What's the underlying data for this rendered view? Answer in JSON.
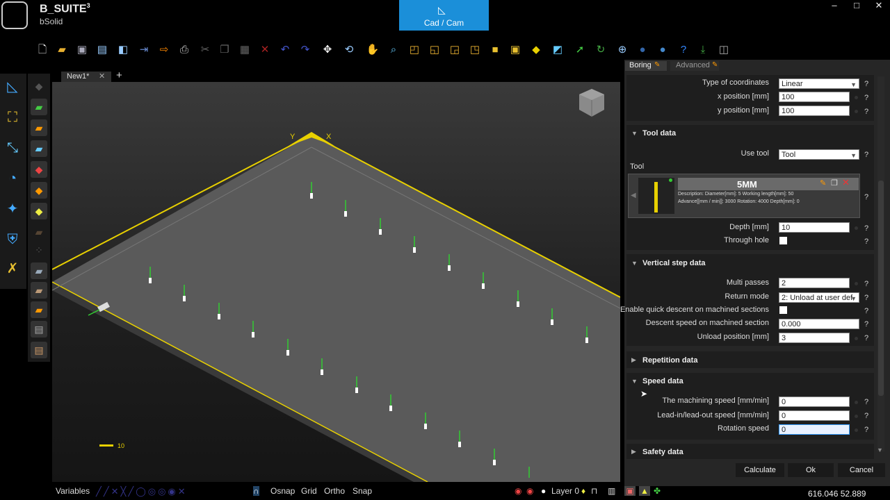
{
  "app": {
    "title": "B_SUITE",
    "title_sup": "3",
    "subtitle": "bSolid"
  },
  "mode_button": {
    "label": "Cad / Cam"
  },
  "window": {
    "minimize": "–",
    "maximize": "□",
    "close": "✕"
  },
  "document_tab": {
    "label": "New1*",
    "close": "✕",
    "add": "+"
  },
  "panel": {
    "tabs": [
      "Boring",
      "Advanced"
    ],
    "coordinates": {
      "type_label": "Type of coordinates",
      "type_value": "Linear",
      "x_label": "x position  [mm]",
      "x_value": "100",
      "y_label": "y position  [mm]",
      "y_value": "100"
    },
    "tool_data": {
      "header": "Tool data",
      "use_tool_label": "Use tool",
      "use_tool_value": "Tool",
      "tool_label": "Tool",
      "tool_name": "5MM",
      "tool_line1": "Description:  Diameter[mm]: 5  Working length[mm]: 50",
      "tool_line2": "Advance[[mm / min]]: 3000  Rotation: 4000  Depth[mm]: 0",
      "depth_label": "Depth  [mm]",
      "depth_value": "10",
      "through_label": "Through hole"
    },
    "vertical_step": {
      "header": "Vertical step data",
      "multi_label": "Multi passes",
      "multi_value": "2",
      "return_label": "Return mode",
      "return_value": "2: Unload at user def",
      "quick_label": "Enable quick descent on machined sections",
      "descent_label": "Descent speed on machined section",
      "descent_value": "0.000",
      "unload_label": "Unload position  [mm]",
      "unload_value": "3"
    },
    "repetition": {
      "header": "Repetition data"
    },
    "speed": {
      "header": "Speed data",
      "machining_label": "The machining speed  [mm/min]",
      "machining_value": "0",
      "leadin_label": "Lead-in/lead-out speed  [mm/min]",
      "leadin_value": "0",
      "rotation_label": "Rotation speed",
      "rotation_value": "0"
    },
    "safety": {
      "header": "Safety data"
    },
    "help": "?",
    "buttons": {
      "calculate": "Calculate",
      "ok": "Ok",
      "cancel": "Cancel"
    }
  },
  "viewport": {
    "axis_x": "X",
    "axis_y": "Y",
    "scale_label": "10"
  },
  "statusbar": {
    "variables": "Variables",
    "osnap": "Osnap",
    "grid": "Grid",
    "ortho": "Ortho",
    "snap": "Snap",
    "layer": "Layer 0",
    "coords": "616.046  52.889"
  },
  "colors": {
    "accent": "#1b8fd9",
    "edge": "#e8d000",
    "panel_bg": "#262626"
  }
}
